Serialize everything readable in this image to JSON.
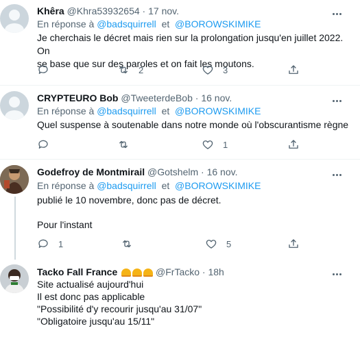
{
  "tweets": [
    {
      "name": "Khêra",
      "handle": "@Khra53932654",
      "separator": "·",
      "time": "17 nov.",
      "reply_prefix": "En réponse à",
      "mention1": "@badsquirrell",
      "reply_and": "et",
      "mention2": "@BOROWSKIMIKE",
      "text_lines": [
        "Je cherchais le décret mais rien sur la prolongation jusqu'en juillet 2022. On",
        "se base que sur des paroles et on fait les moutons."
      ],
      "replies": "",
      "retweets": "2",
      "likes": "3"
    },
    {
      "name": "CRYPTEURO Bob",
      "handle": "@TweeterdeBob",
      "separator": "·",
      "time": "16 nov.",
      "reply_prefix": "En réponse à",
      "mention1": "@badsquirrell",
      "reply_and": "et",
      "mention2": "@BOROWSKIMIKE",
      "text_lines": [
        "Quel suspense à soutenable dans notre monde où  l'obscurantisme règne"
      ],
      "replies": "",
      "retweets": "",
      "likes": "1"
    },
    {
      "name": "Godefroy de Montmirail",
      "handle": "@Gotshelm",
      "separator": "·",
      "time": "16 nov.",
      "reply_prefix": "En réponse à",
      "mention1": "@badsquirrell",
      "reply_and": "et",
      "mention2": "@BOROWSKIMIKE",
      "text_lines": [
        "publié le 10 novembre, donc pas de décret.",
        "",
        "Pour l'instant"
      ],
      "replies": "1",
      "retweets": "",
      "likes": "5"
    },
    {
      "name": "Tacko Fall France",
      "handle": "@FrTacko",
      "separator": "·",
      "time": "18h",
      "text_lines": [
        "Site actualisé aujourd'hui",
        "Il est donc pas applicable",
        "\"Possibilité d'y recourir jusqu'au 31/07\"",
        "\"Obligatoire jusqu'au 15/11\""
      ]
    }
  ],
  "colors": {
    "accent": "#1d9bf0",
    "muted": "#536471",
    "text": "#0f1419"
  },
  "icons": [
    "reply-icon",
    "retweet-icon",
    "like-icon",
    "share-icon",
    "more-icon"
  ]
}
